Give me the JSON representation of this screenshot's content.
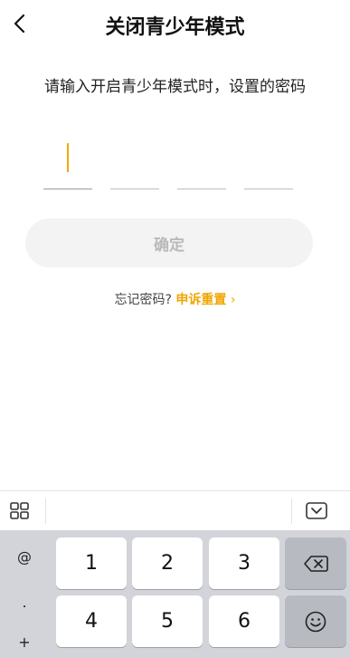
{
  "header": {
    "title": "关闭青少年模式"
  },
  "prompt": {
    "text": "请输入开启青少年模式时，设置的密码"
  },
  "pin": {
    "length": 4,
    "filled": 0
  },
  "confirm": {
    "label": "确定"
  },
  "forgot": {
    "text": "忘记密码?",
    "link": "申诉重置",
    "chevron": "›"
  },
  "keyboard": {
    "symbols": [
      "@",
      ".",
      "+"
    ],
    "keys": [
      "1",
      "2",
      "3",
      "4",
      "5",
      "6"
    ]
  },
  "colors": {
    "accent": "#f0a500",
    "disabled_text": "#b9b9b9",
    "disabled_bg": "#f3f3f3"
  }
}
